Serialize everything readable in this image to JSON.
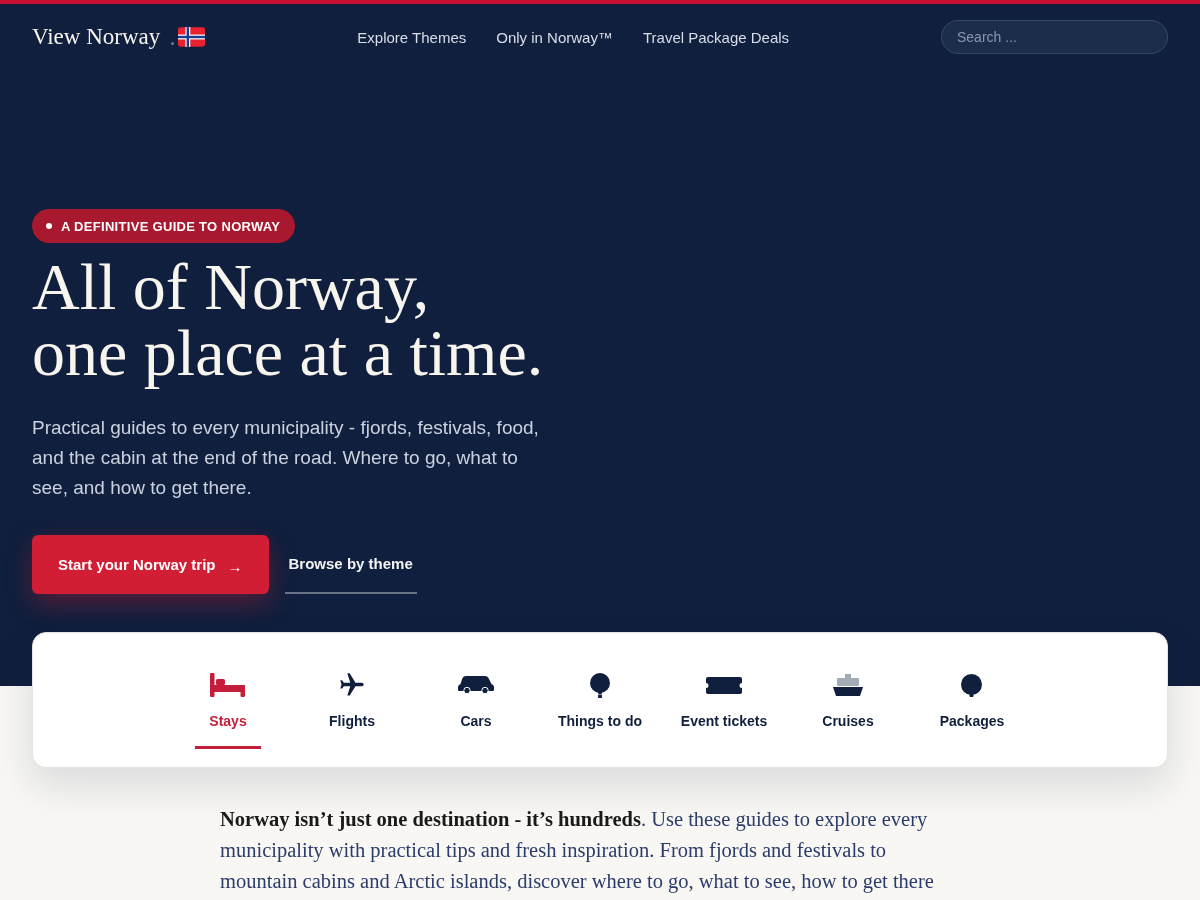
{
  "header": {
    "logo": "View Norway",
    "nav": [
      "Explore Themes",
      "Only in Norway™",
      "Travel Package Deals"
    ],
    "search": {
      "placeholder": "Search ..."
    }
  },
  "hero": {
    "badge": "A DEFINITIVE GUIDE TO NORWAY",
    "headline": [
      "All of Norway,",
      "one place at a time."
    ],
    "description": "Practical guides to every municipality - fjords, festivals, food, and the cabin at the end of the road. Where to go, what to see, and how to get there.",
    "primary_button": {
      "label": "Start your Norway trip",
      "arrow": "→"
    },
    "secondary_link": "Browse by theme"
  },
  "categories": [
    {
      "label": "Stays",
      "selected": true
    },
    {
      "label": "Flights",
      "selected": false
    },
    {
      "label": "Cars",
      "selected": false
    },
    {
      "label": "Things to do",
      "selected": false
    },
    {
      "label": "Event tickets",
      "selected": false
    },
    {
      "label": "Cruises",
      "selected": false
    },
    {
      "label": "Packages",
      "selected": false
    }
  ],
  "intro": "**Norway isn’t just one destination - it’s hundreds**. Use these guides to explore every municipality with practical tips and fresh inspiration. From fjords and festivals to mountain cabins and Arctic islands, discover where to go, what to see, how to get there"
}
